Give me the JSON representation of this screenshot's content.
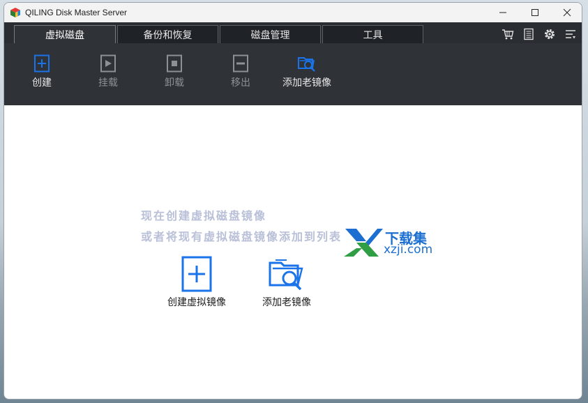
{
  "window": {
    "title": "QILING Disk Master Server"
  },
  "tabs": [
    {
      "label": "虚拟磁盘",
      "active": true
    },
    {
      "label": "备份和恢复",
      "active": false
    },
    {
      "label": "磁盘管理",
      "active": false
    },
    {
      "label": "工具",
      "active": false
    }
  ],
  "header_icons": [
    "cart-icon",
    "notes-icon",
    "gear-icon",
    "menu-icon"
  ],
  "toolbar": {
    "create": "创建",
    "mount": "挂载",
    "unmount": "卸载",
    "remove": "移出",
    "add_old_image": "添加老镜像"
  },
  "content": {
    "hint_line1": "现在创建虚拟磁盘镜像",
    "hint_line2": "或者将现有虚拟磁盘镜像添加到列表",
    "create_image_label": "创建虚拟镜像",
    "add_old_image_label": "添加老镜像"
  },
  "watermark": {
    "line1": "下载集",
    "line2": "xzji.com"
  },
  "colors": {
    "accent": "#1a73e8",
    "toolbar_bg": "#2f3338",
    "tabbar_bg": "#2a2e33"
  }
}
